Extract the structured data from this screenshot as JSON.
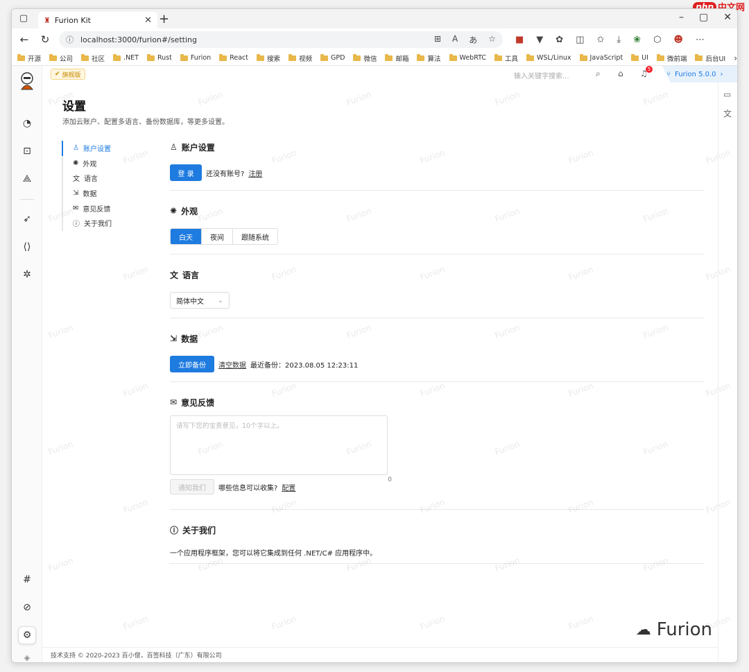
{
  "watermark_site": {
    "badge": "php",
    "text": "中文网"
  },
  "browser": {
    "tab_title": "Furion Kit",
    "url": "localhost:3000/furion#/setting",
    "bookmarks": [
      "开源",
      "公司",
      "社区",
      ".NET",
      "Rust",
      "Furion",
      "React",
      "搜索",
      "视频",
      "GPD",
      "微信",
      "邮箱",
      "算法",
      "WebRTC",
      "工具",
      "WSL/Linux",
      "JavaScript",
      "UI",
      "微前端",
      "后台UI"
    ]
  },
  "topbar": {
    "edition_badge": "旗舰版",
    "search_placeholder": "输入关键字搜索...",
    "notification_count": "5",
    "version": "Furion 5.0.0"
  },
  "page": {
    "title": "设置",
    "subtitle": "添加云账户、配置多语言、备份数据库，等更多设置。"
  },
  "nav": [
    "账户设置",
    "外观",
    "语言",
    "数据",
    "意见反馈",
    "关于我们"
  ],
  "account": {
    "heading": "账户设置",
    "login_label": "登 录",
    "no_account_text": "还没有账号?",
    "register_label": "注册"
  },
  "appearance": {
    "heading": "外观",
    "options": [
      "白天",
      "夜间",
      "跟随系统"
    ],
    "selected": "白天"
  },
  "language": {
    "heading": "语言",
    "selected": "简体中文"
  },
  "data": {
    "heading": "数据",
    "backup_label": "立即备份",
    "clear_label": "清空数据",
    "last_backup_text": "最近备份：2023.08.05 12:23:11"
  },
  "feedback": {
    "heading": "意见反馈",
    "placeholder": "请写下您的宝贵意见，10个字以上。",
    "char_count": "0",
    "submit_label": "通知我们",
    "question_text": "哪些信息可以收集?",
    "config_label": "配置"
  },
  "about": {
    "heading": "关于我们",
    "description": "一个应用程序框架，您可以将它集成到任何 .NET/C# 应用程序中。"
  },
  "footer": {
    "text": "技术支持 © 2020-2023 百小僧，百签科技（广东）有限公司"
  },
  "watermark_text": "Furion",
  "brand_watermark": "Furion",
  "colors": {
    "accent": "#1e7be0",
    "badge_bg": "#fff7e0",
    "notification": "#f5222d"
  }
}
